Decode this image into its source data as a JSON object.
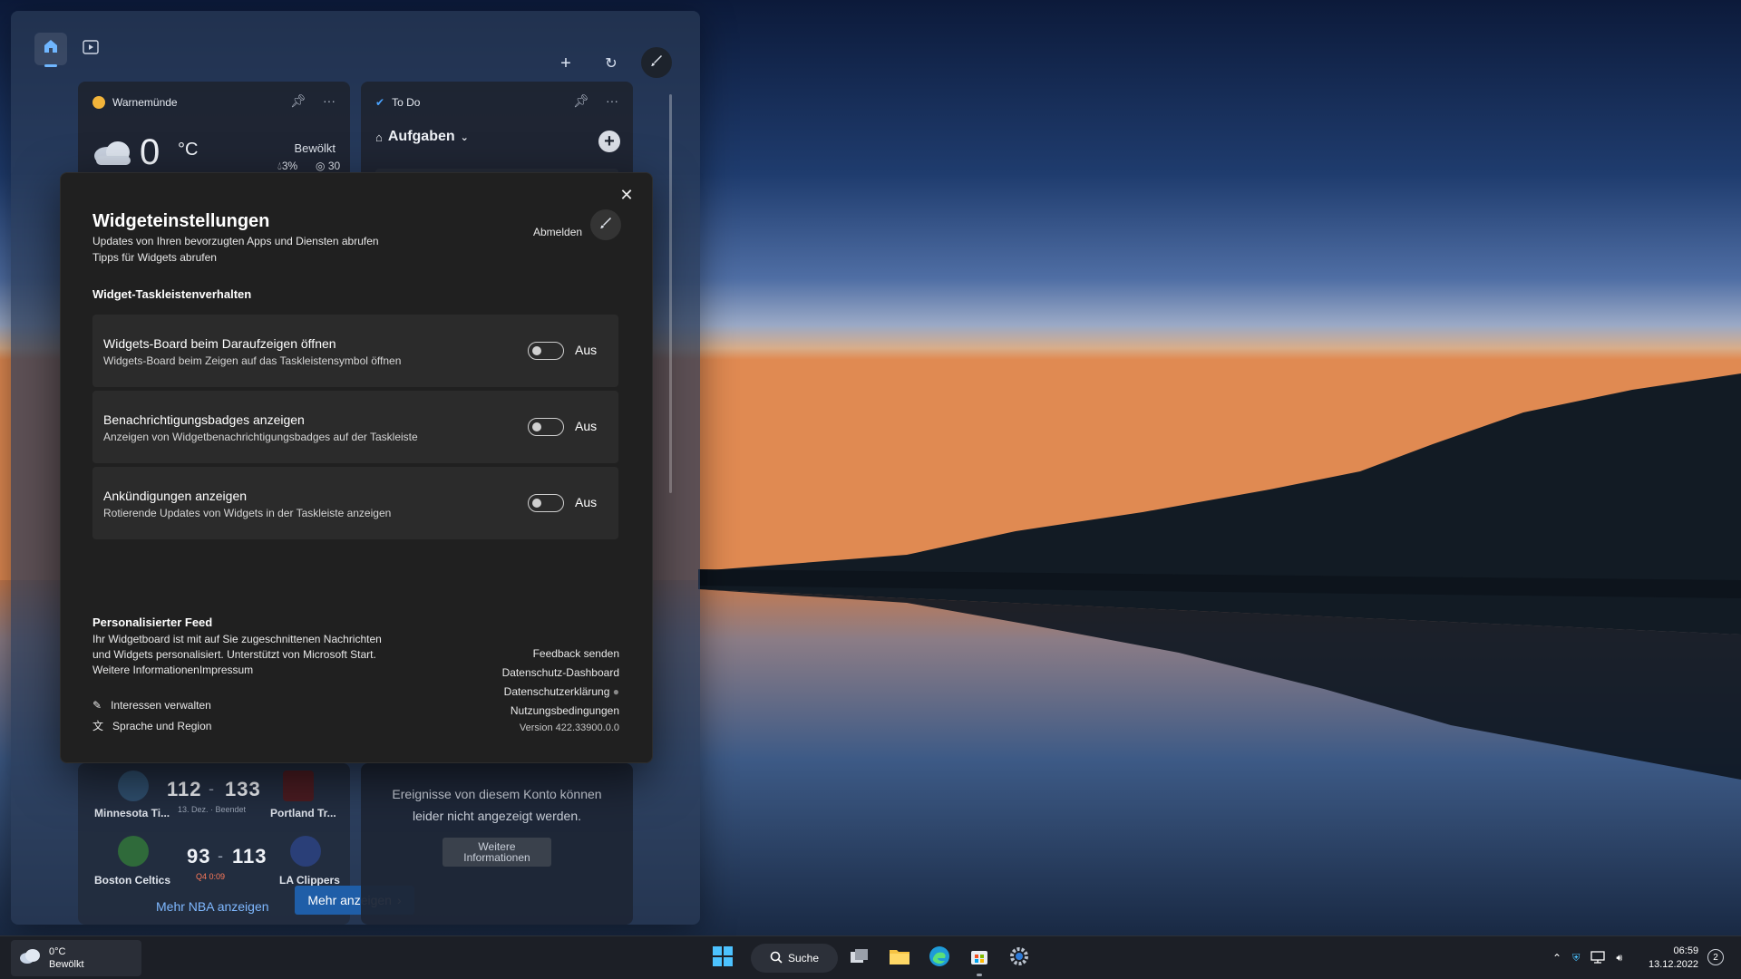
{
  "board": {
    "weather": {
      "location": "Warnemünde",
      "temp": "0",
      "unit": "°C",
      "condition": "Bewölkt",
      "precip": "3%",
      "aqi": "30"
    },
    "todo": {
      "title": "To Do",
      "list_label": "Aufgaben"
    },
    "nba": {
      "game1": {
        "team_a": "Minnesota Ti...",
        "score_a": "112",
        "score_b": "133",
        "team_b": "Portland Tr...",
        "status": "13. Dez. · Beendet"
      },
      "game2": {
        "team_a": "Boston Celtics",
        "score_a": "93",
        "score_b": "113",
        "team_b": "LA Clippers",
        "status": "Q4 0:09"
      },
      "more_nba": "Mehr NBA anzeigen",
      "more": "Mehr anzeigen"
    },
    "events": {
      "message": "Ereignisse von diesem Konto können leider nicht angezeigt werden.",
      "button": "Weitere Informationen"
    }
  },
  "dialog": {
    "title": "Widgeteinstellungen",
    "sub1": "Updates von Ihren bevorzugten Apps und Diensten abrufen",
    "sub2": "Tipps für Widgets abrufen",
    "signout": "Abmelden",
    "section_taskbar": "Widget-Taskleistenverhalten",
    "rows": [
      {
        "title": "Widgets-Board beim Daraufzeigen öffnen",
        "desc": "Widgets-Board beim Zeigen auf das Taskleistensymbol öffnen",
        "state": "Aus"
      },
      {
        "title": "Benachrichtigungsbadges anzeigen",
        "desc": "Anzeigen von Widgetbenachrichtigungsbadges auf der Taskleiste",
        "state": "Aus"
      },
      {
        "title": "Ankündigungen anzeigen",
        "desc": "Rotierende Updates von Widgets in der Taskleiste anzeigen",
        "state": "Aus"
      }
    ],
    "feed": {
      "title": "Personalisierter Feed",
      "line1": "Ihr Widgetboard ist mit auf Sie zugeschnittenen Nachrichten",
      "line2": "und Widgets personalisiert. Unterstützt von Microsoft Start.",
      "line3": "Weitere InformationenImpressum"
    },
    "links": {
      "interests": "Interessen verwalten",
      "language": "Sprache und Region",
      "feedback": "Feedback senden",
      "privacy_dashboard": "Datenschutz-Dashboard",
      "privacy_statement": "Datenschutzerklärung",
      "terms": "Nutzungsbedingungen",
      "version": "Version 422.33900.0.0"
    }
  },
  "taskbar": {
    "weather_temp": "0°C",
    "weather_cond": "Bewölkt",
    "search": "Suche",
    "time": "06:59",
    "date": "13.12.2022",
    "notif_count": "2"
  },
  "colors": {
    "accent": "#4cc2ff",
    "dialog_bg": "#202020",
    "row_bg": "#2b2b2b"
  }
}
